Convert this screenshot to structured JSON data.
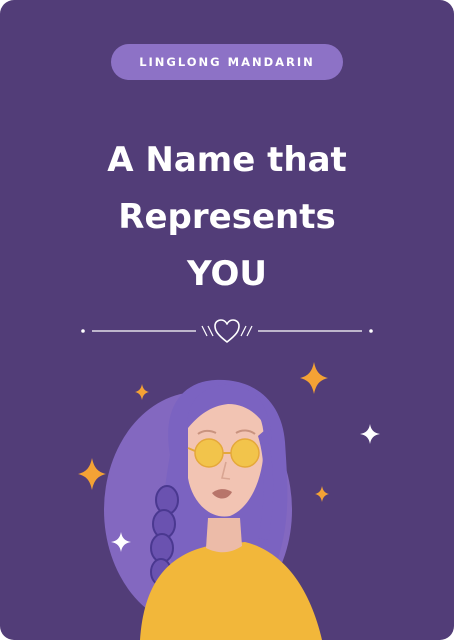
{
  "badge": {
    "label": "LINGLONG MANDARIN"
  },
  "headline": {
    "line1": "A Name that",
    "line2": "Represents",
    "line3": "YOU"
  },
  "colors": {
    "background": "#523d78",
    "badge": "#8d72c6",
    "text": "#ffffff",
    "sparkle_orange": "#f4a235",
    "shirt": "#f2b73a",
    "hair": "#7b63c1"
  },
  "icons": [
    "heart-icon",
    "sparkle-icon",
    "woman-illustration"
  ]
}
